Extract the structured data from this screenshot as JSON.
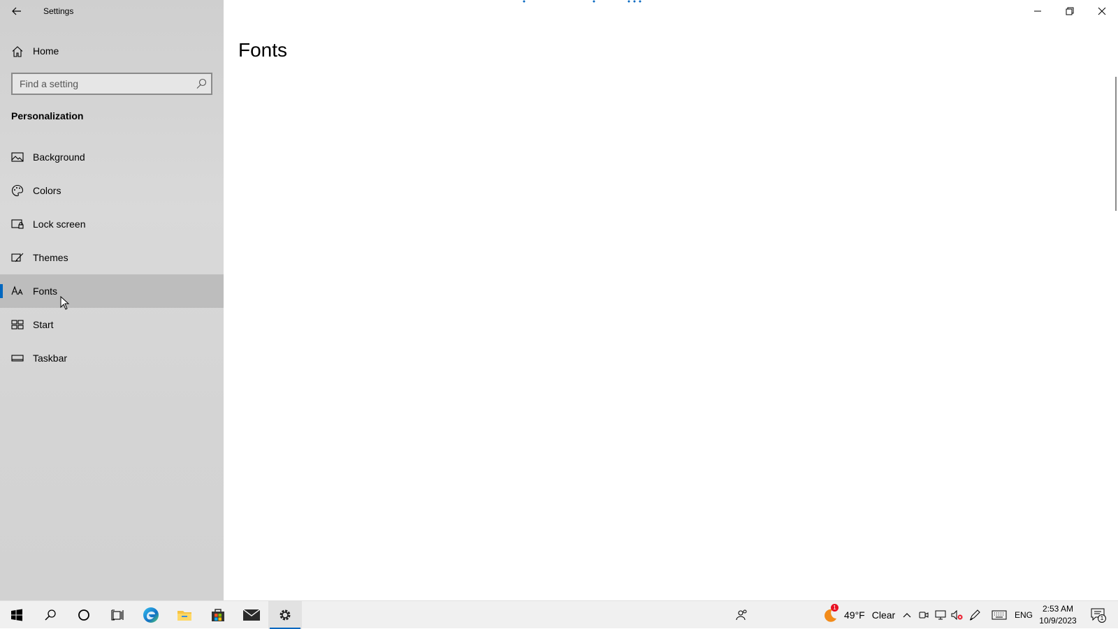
{
  "window": {
    "app_title": "Settings"
  },
  "sidebar": {
    "home_label": "Home",
    "search_placeholder": "Find a setting",
    "section_title": "Personalization",
    "items": [
      {
        "label": "Background",
        "icon": "picture-icon"
      },
      {
        "label": "Colors",
        "icon": "palette-icon"
      },
      {
        "label": "Lock screen",
        "icon": "lock-screen-icon"
      },
      {
        "label": "Themes",
        "icon": "brush-icon"
      },
      {
        "label": "Fonts",
        "icon": "font-icon",
        "selected": true
      },
      {
        "label": "Start",
        "icon": "start-layout-icon"
      },
      {
        "label": "Taskbar",
        "icon": "taskbar-icon"
      }
    ]
  },
  "main": {
    "page_title": "Fonts"
  },
  "taskbar": {
    "apps": [
      "start",
      "search",
      "cortana",
      "task-view",
      "edge",
      "file-explorer",
      "store",
      "mail",
      "settings"
    ],
    "active_app": "settings",
    "weather": {
      "temp": "49°F",
      "condition": "Clear",
      "badge": "1"
    },
    "language": "ENG",
    "time": "2:53 AM",
    "date": "10/9/2023",
    "notification_count": "1"
  },
  "colors": {
    "accent": "#0067c0",
    "sidebar_bg": "#d6d6d6",
    "selected_bg": "#bdbdbd"
  }
}
